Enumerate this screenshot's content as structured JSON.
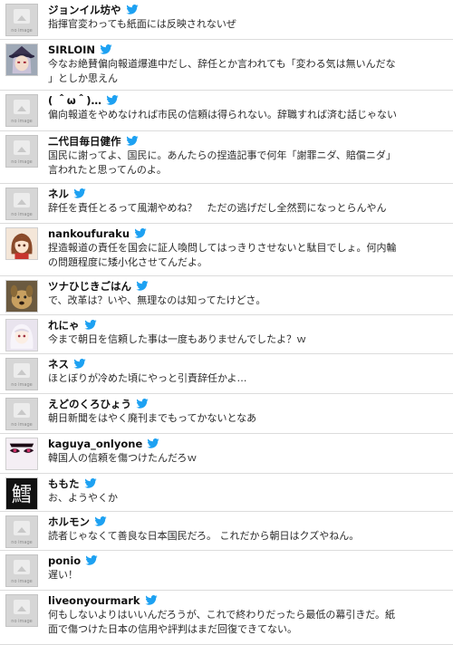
{
  "brand_color": "#1da1f2",
  "tweets": [
    {
      "user": "ジョンイル坊や",
      "avatar": "no-image",
      "text1": "指揮官変わっても紙面には反映されないぜ",
      "text2": ""
    },
    {
      "user": "SIRLOIN",
      "avatar": "anime-girl-hat",
      "text1": "今なお絶賛偏向報道爆進中だし、辞任とか言われても「変わる気は無いんだな",
      "text2": "」としか思えん"
    },
    {
      "user": "( ＾ω＾)…",
      "avatar": "no-image",
      "text1": "偏向報道をやめなければ市民の信頼は得られない。辞職すれば済む話じゃない",
      "text2": ""
    },
    {
      "user": "二代目毎日健作",
      "avatar": "no-image",
      "text1": "国民に謝ってよ、国民に。あんたらの捏造記事で何年「謝罪ニダ、賠償ニダ」",
      "text2": "言われたと思ってんのよ。"
    },
    {
      "user": "ネル",
      "avatar": "no-image",
      "text1": "辞任を責任とるって風潮やめね？　ただの逃げだし全然罰になっとらんやん",
      "text2": ""
    },
    {
      "user": "nankoufuraku",
      "avatar": "anime-girl-brown",
      "text1": "捏造報道の責任を国会に証人喚問してはっきりさせないと駄目でしょ。何内輪",
      "text2": "の問題程度に矮小化させてんだよ。"
    },
    {
      "user": "ツナひじきごはん",
      "avatar": "dog-photo",
      "text1": "で、改革は？いや、無理なのは知ってたけどさ。",
      "text2": ""
    },
    {
      "user": "れにゃ",
      "avatar": "anime-girl-white",
      "text1": "今まで朝日を信頼した事は一度もありませんでしたよ？ｗ",
      "text2": ""
    },
    {
      "user": "ネス",
      "avatar": "no-image",
      "text1": "ほとぼりが冷めた頃にやっと引責辞任かよ…",
      "text2": ""
    },
    {
      "user": "えどのくろひょう",
      "avatar": "no-image",
      "text1": "朝日新聞をはやく廃刊までもってかないとなあ",
      "text2": ""
    },
    {
      "user": "kaguya_onlyone",
      "avatar": "anime-eyes",
      "text1": "韓国人の信頼を傷つけたんだろｗ",
      "text2": ""
    },
    {
      "user": "ももた",
      "avatar": "kanji-black",
      "avatar_glyph": "鱈",
      "text1": "お、ようやくか",
      "text2": ""
    },
    {
      "user": "ホルモン",
      "avatar": "no-image",
      "text1": "読者じゃなくて善良な日本国民だろ。 これだから朝日はクズやねん。",
      "text2": ""
    },
    {
      "user": "ponio",
      "avatar": "no-image",
      "text1": "遅い！",
      "text2": ""
    },
    {
      "user": "liveonyourmark",
      "avatar": "no-image",
      "text1": "何もしないよりはいいんだろうが、これで終わりだったら最低の幕引きだ。紙",
      "text2": "面で傷つけた日本の信用や評判はまだ回復できてない。"
    }
  ],
  "no_image_label": "no image"
}
